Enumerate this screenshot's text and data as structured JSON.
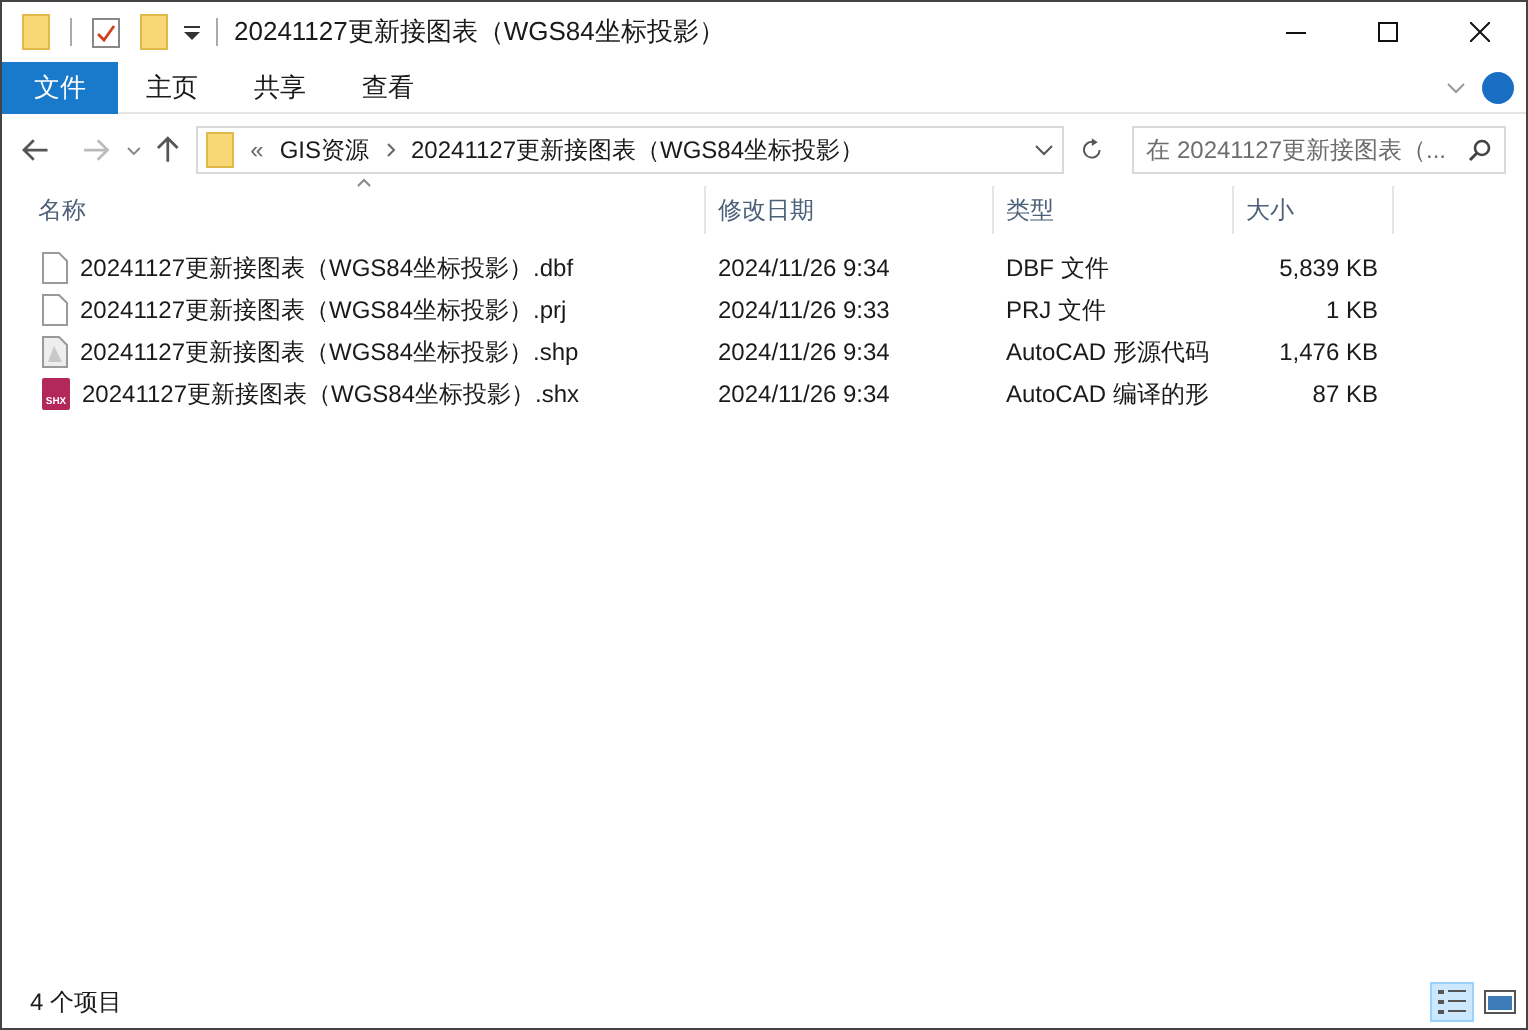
{
  "window": {
    "title": "20241127更新接图表（WGS84坐标投影）"
  },
  "ribbon_tabs": [
    {
      "label": "文件",
      "kind": "file"
    },
    {
      "label": "主页",
      "kind": "tab"
    },
    {
      "label": "共享",
      "kind": "tab"
    },
    {
      "label": "查看",
      "kind": "tab"
    }
  ],
  "address": {
    "overflow": "«",
    "crumbs": [
      "GIS资源",
      "20241127更新接图表（WGS84坐标投影）"
    ]
  },
  "search": {
    "placeholder": "在 20241127更新接图表（... "
  },
  "columns": [
    "名称",
    "修改日期",
    "类型",
    "大小"
  ],
  "files": [
    {
      "name": "20241127更新接图表（WGS84坐标投影）.dbf",
      "date": "2024/11/26 9:34",
      "type": "DBF 文件",
      "size": "5,839 KB",
      "kind": "blank"
    },
    {
      "name": "20241127更新接图表（WGS84坐标投影）.prj",
      "date": "2024/11/26 9:33",
      "type": "PRJ 文件",
      "size": "1 KB",
      "kind": "blank"
    },
    {
      "name": "20241127更新接图表（WGS84坐标投影）.shp",
      "date": "2024/11/26 9:34",
      "type": "AutoCAD 形源代码",
      "size": "1,476 KB",
      "kind": "cad"
    },
    {
      "name": "20241127更新接图表（WGS84坐标投影）.shx",
      "date": "2024/11/26 9:34",
      "type": "AutoCAD 编译的形",
      "size": "87 KB",
      "kind": "shx",
      "badge": "SHX"
    }
  ],
  "status_bar": {
    "count": "4 个项目",
    "views": [
      {
        "kind": "details",
        "selected": true
      },
      {
        "kind": "tiles",
        "selected": false
      }
    ]
  }
}
